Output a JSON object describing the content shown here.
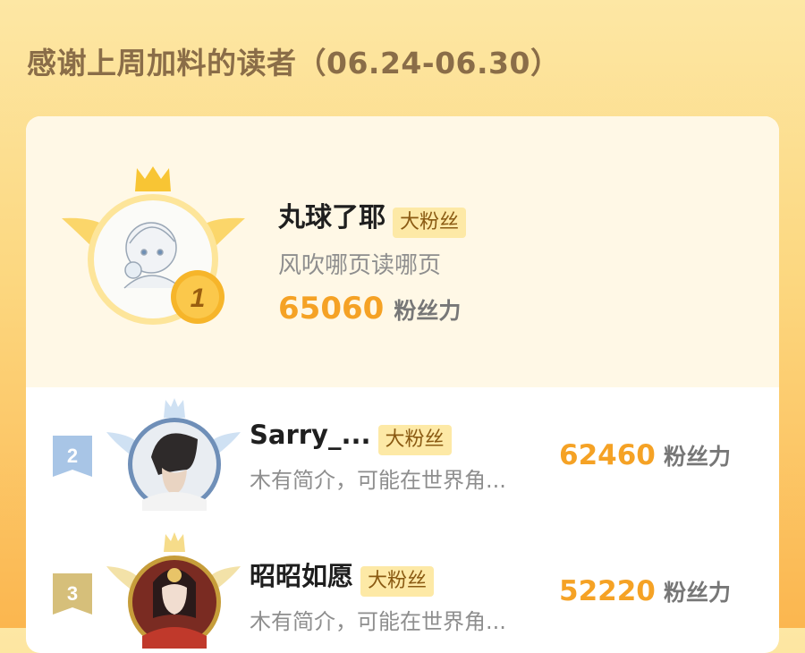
{
  "header": {
    "title": "感谢上周加料的读者（06.24-06.30）"
  },
  "top_reader": {
    "rank": "1",
    "name": "丸球了耶",
    "badge": "大粉丝",
    "bio": "风吹哪页读哪页",
    "score": "65060",
    "score_unit": "粉丝力"
  },
  "readers": [
    {
      "rank": "2",
      "name": "Sarry_...",
      "badge": "大粉丝",
      "bio": "木有简介，可能在世界角...",
      "score": "62460",
      "score_unit": "粉丝力"
    },
    {
      "rank": "3",
      "name": "昭昭如愿",
      "badge": "大粉丝",
      "bio": "木有简介，可能在世界角...",
      "score": "52220",
      "score_unit": "粉丝力"
    }
  ],
  "colors": {
    "accent": "#f5a225",
    "badge_bg": "#fde9a6",
    "title": "#8a6d48"
  }
}
